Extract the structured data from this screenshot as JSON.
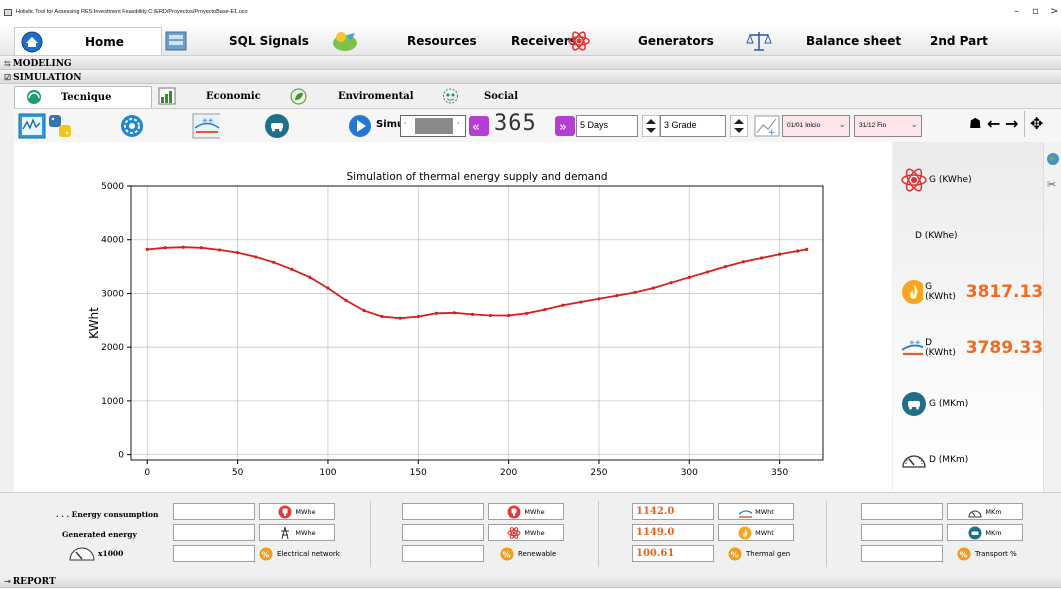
{
  "window": {
    "title": "Holistic Tool for Assessing RES Investment Feasibility:C:/ERD/Proyectos/ProyectoBase-E1.uco",
    "minimize": "–",
    "maximize": "▫",
    "close": "✕"
  },
  "main_tabs": {
    "home": "Home",
    "sql": "SQL Signals",
    "resources": "Resources",
    "receivers": "Receivers",
    "generators": "Generators",
    "balance": "Balance sheet",
    "second": "2nd Part"
  },
  "sections": {
    "modeling": "MODELING",
    "simulation": "SIMULATION",
    "report": "REPORT"
  },
  "sub_tabs": {
    "tecnique": "Tecnique",
    "economic": "Economic",
    "enviromental": "Enviromental",
    "social": "Social"
  },
  "toolbar": {
    "simul_label": "Simul",
    "day_value": "365",
    "days_select": "5 Days",
    "grade_select": "3 Grade",
    "start_select": "01/01 Inicio",
    "end_select": "31/12  Fin",
    "arrow_chev": "»"
  },
  "chart_data": {
    "type": "line",
    "title": "Simulation of thermal energy supply and demand",
    "xlabel": "",
    "ylabel": "KWht",
    "xlim": [
      -9,
      374
    ],
    "ylim": [
      -100,
      5000
    ],
    "xticks": [
      0,
      50,
      100,
      150,
      200,
      250,
      300,
      350
    ],
    "yticks": [
      0,
      1000,
      2000,
      3000,
      4000,
      5000
    ],
    "grid": true,
    "series": [
      {
        "color": "#d42020",
        "style": "dotted-markers",
        "x": [
          0,
          10,
          20,
          30,
          40,
          50,
          60,
          70,
          80,
          90,
          100,
          110,
          120,
          130,
          140,
          150,
          160,
          170,
          180,
          190,
          200,
          210,
          220,
          230,
          240,
          250,
          260,
          270,
          280,
          290,
          300,
          310,
          320,
          330,
          340,
          350,
          360,
          365
        ],
        "y": [
          3820,
          3850,
          3860,
          3850,
          3810,
          3760,
          3680,
          3580,
          3450,
          3300,
          3100,
          2870,
          2680,
          2570,
          2540,
          2570,
          2630,
          2640,
          2610,
          2590,
          2590,
          2630,
          2700,
          2780,
          2840,
          2900,
          2960,
          3020,
          3100,
          3200,
          3300,
          3400,
          3500,
          3590,
          3660,
          3730,
          3790,
          3820
        ]
      }
    ]
  },
  "legend_panel": {
    "g_kwhe": "G (KWhe)",
    "d_kwhe": "D (KWhe)",
    "g_kwht": "G (KWht)",
    "g_kwht_value": "3817.13",
    "d_kwht": "D (KWht)",
    "d_kwht_value": "3789.33",
    "g_mkm": "G (MKm)",
    "d_mkm": "D (MKm)"
  },
  "bottom": {
    "energy_consumption": ". . . Energy consumption",
    "generated_energy": "Generated energy",
    "x1000": "x1000",
    "mwhe": "MWhe",
    "mwht": "MWht",
    "mkm": "MKm",
    "electrical_network": "Electrical network",
    "renewable": "Renewable",
    "thermal_gen": "Thermal gen",
    "transport": "Transport %",
    "thermal_consumption": "1142.0",
    "thermal_generated": "1149.0",
    "thermal_percent": "100.61"
  },
  "colors": {
    "accent_orange": "#f26a1b",
    "line_red": "#d42020"
  }
}
